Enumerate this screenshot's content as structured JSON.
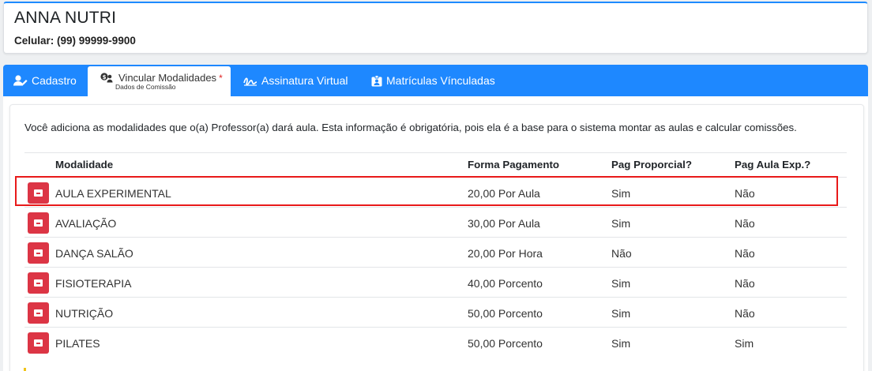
{
  "profile": {
    "name": "ANNA NUTRI",
    "phone_label": "Celular: (99) 99999-9900"
  },
  "tabs": [
    {
      "label": "Cadastro",
      "icon": "user-edit-icon"
    },
    {
      "label": "Vincular Modalidades",
      "sublabel": "Dados de Comissão",
      "required_mark": "*",
      "icon": "money-users-icon",
      "active": true
    },
    {
      "label": "Assinatura Virtual",
      "icon": "signature-icon"
    },
    {
      "label": "Matrículas Vínculadas",
      "icon": "id-badge-icon"
    }
  ],
  "info_text": "Você adiciona as modalidades que o(a) Professor(a) dará aula. Esta informação é obrigatória, pois ela é a base para o sistema montar as aulas e calcular comissões.",
  "table": {
    "headers": [
      "Modalidade",
      "Forma Pagamento",
      "Pag Proporcial?",
      "Pag Aula Exp.?"
    ],
    "rows": [
      {
        "modalidade": "AULA EXPERIMENTAL",
        "forma": "20,00 Por Aula",
        "proporcial": "Sim",
        "aula_exp": "Não"
      },
      {
        "modalidade": "AVALIAÇÃO",
        "forma": "30,00 Por Aula",
        "proporcial": "Sim",
        "aula_exp": "Não"
      },
      {
        "modalidade": "DANÇA SALÃO",
        "forma": "20,00 Por Hora",
        "proporcial": "Não",
        "aula_exp": "Não"
      },
      {
        "modalidade": "FISIOTERAPIA",
        "forma": "40,00 Porcento",
        "proporcial": "Sim",
        "aula_exp": "Não"
      },
      {
        "modalidade": "NUTRIÇÃO",
        "forma": "50,00 Porcento",
        "proporcial": "Sim",
        "aula_exp": "Não"
      },
      {
        "modalidade": "PILATES",
        "forma": "50,00 Porcento",
        "proporcial": "Sim",
        "aula_exp": "Sim"
      }
    ]
  },
  "colors": {
    "tabbar": "#1e88ff",
    "delete_button": "#dc3545",
    "highlight": "#e81a1a",
    "required": "#e02424"
  }
}
